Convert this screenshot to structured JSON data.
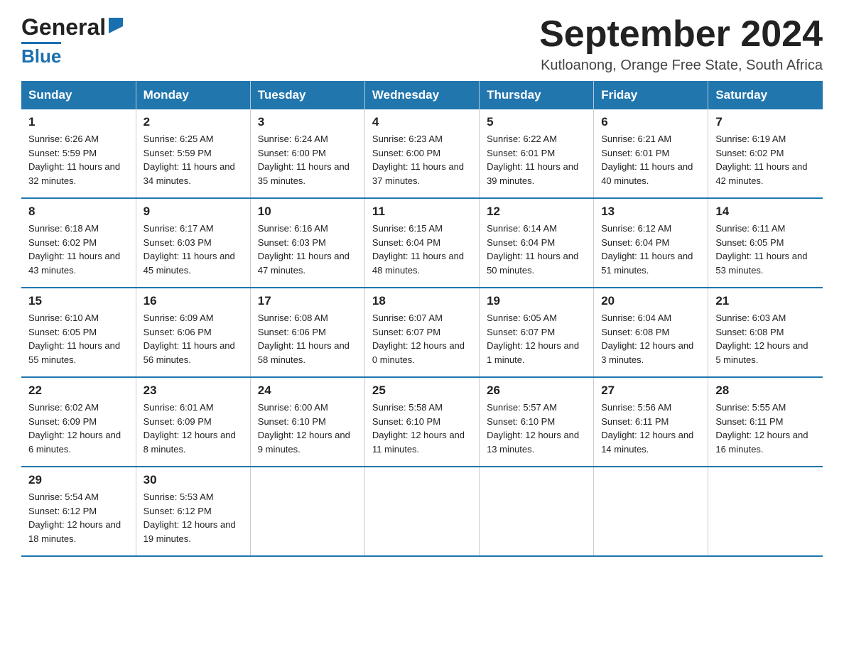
{
  "header": {
    "logo_general": "General",
    "logo_blue": "Blue",
    "month_year": "September 2024",
    "location": "Kutloanong, Orange Free State, South Africa"
  },
  "weekdays": [
    "Sunday",
    "Monday",
    "Tuesday",
    "Wednesday",
    "Thursday",
    "Friday",
    "Saturday"
  ],
  "weeks": [
    [
      {
        "day": "1",
        "sunrise": "6:26 AM",
        "sunset": "5:59 PM",
        "daylight": "11 hours and 32 minutes."
      },
      {
        "day": "2",
        "sunrise": "6:25 AM",
        "sunset": "5:59 PM",
        "daylight": "11 hours and 34 minutes."
      },
      {
        "day": "3",
        "sunrise": "6:24 AM",
        "sunset": "6:00 PM",
        "daylight": "11 hours and 35 minutes."
      },
      {
        "day": "4",
        "sunrise": "6:23 AM",
        "sunset": "6:00 PM",
        "daylight": "11 hours and 37 minutes."
      },
      {
        "day": "5",
        "sunrise": "6:22 AM",
        "sunset": "6:01 PM",
        "daylight": "11 hours and 39 minutes."
      },
      {
        "day": "6",
        "sunrise": "6:21 AM",
        "sunset": "6:01 PM",
        "daylight": "11 hours and 40 minutes."
      },
      {
        "day": "7",
        "sunrise": "6:19 AM",
        "sunset": "6:02 PM",
        "daylight": "11 hours and 42 minutes."
      }
    ],
    [
      {
        "day": "8",
        "sunrise": "6:18 AM",
        "sunset": "6:02 PM",
        "daylight": "11 hours and 43 minutes."
      },
      {
        "day": "9",
        "sunrise": "6:17 AM",
        "sunset": "6:03 PM",
        "daylight": "11 hours and 45 minutes."
      },
      {
        "day": "10",
        "sunrise": "6:16 AM",
        "sunset": "6:03 PM",
        "daylight": "11 hours and 47 minutes."
      },
      {
        "day": "11",
        "sunrise": "6:15 AM",
        "sunset": "6:04 PM",
        "daylight": "11 hours and 48 minutes."
      },
      {
        "day": "12",
        "sunrise": "6:14 AM",
        "sunset": "6:04 PM",
        "daylight": "11 hours and 50 minutes."
      },
      {
        "day": "13",
        "sunrise": "6:12 AM",
        "sunset": "6:04 PM",
        "daylight": "11 hours and 51 minutes."
      },
      {
        "day": "14",
        "sunrise": "6:11 AM",
        "sunset": "6:05 PM",
        "daylight": "11 hours and 53 minutes."
      }
    ],
    [
      {
        "day": "15",
        "sunrise": "6:10 AM",
        "sunset": "6:05 PM",
        "daylight": "11 hours and 55 minutes."
      },
      {
        "day": "16",
        "sunrise": "6:09 AM",
        "sunset": "6:06 PM",
        "daylight": "11 hours and 56 minutes."
      },
      {
        "day": "17",
        "sunrise": "6:08 AM",
        "sunset": "6:06 PM",
        "daylight": "11 hours and 58 minutes."
      },
      {
        "day": "18",
        "sunrise": "6:07 AM",
        "sunset": "6:07 PM",
        "daylight": "12 hours and 0 minutes."
      },
      {
        "day": "19",
        "sunrise": "6:05 AM",
        "sunset": "6:07 PM",
        "daylight": "12 hours and 1 minute."
      },
      {
        "day": "20",
        "sunrise": "6:04 AM",
        "sunset": "6:08 PM",
        "daylight": "12 hours and 3 minutes."
      },
      {
        "day": "21",
        "sunrise": "6:03 AM",
        "sunset": "6:08 PM",
        "daylight": "12 hours and 5 minutes."
      }
    ],
    [
      {
        "day": "22",
        "sunrise": "6:02 AM",
        "sunset": "6:09 PM",
        "daylight": "12 hours and 6 minutes."
      },
      {
        "day": "23",
        "sunrise": "6:01 AM",
        "sunset": "6:09 PM",
        "daylight": "12 hours and 8 minutes."
      },
      {
        "day": "24",
        "sunrise": "6:00 AM",
        "sunset": "6:10 PM",
        "daylight": "12 hours and 9 minutes."
      },
      {
        "day": "25",
        "sunrise": "5:58 AM",
        "sunset": "6:10 PM",
        "daylight": "12 hours and 11 minutes."
      },
      {
        "day": "26",
        "sunrise": "5:57 AM",
        "sunset": "6:10 PM",
        "daylight": "12 hours and 13 minutes."
      },
      {
        "day": "27",
        "sunrise": "5:56 AM",
        "sunset": "6:11 PM",
        "daylight": "12 hours and 14 minutes."
      },
      {
        "day": "28",
        "sunrise": "5:55 AM",
        "sunset": "6:11 PM",
        "daylight": "12 hours and 16 minutes."
      }
    ],
    [
      {
        "day": "29",
        "sunrise": "5:54 AM",
        "sunset": "6:12 PM",
        "daylight": "12 hours and 18 minutes."
      },
      {
        "day": "30",
        "sunrise": "5:53 AM",
        "sunset": "6:12 PM",
        "daylight": "12 hours and 19 minutes."
      },
      null,
      null,
      null,
      null,
      null
    ]
  ]
}
